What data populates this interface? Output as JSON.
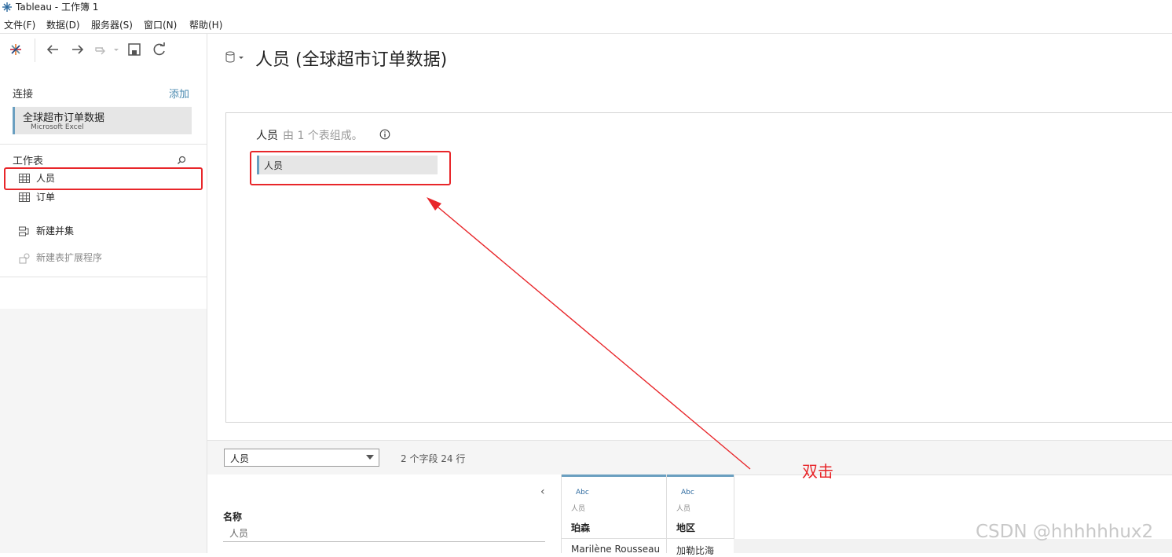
{
  "window": {
    "title": "Tableau - 工作簿 1"
  },
  "menu": {
    "items": [
      "文件(F)",
      "数据(D)",
      "服务器(S)",
      "窗口(N)",
      "帮助(H)"
    ]
  },
  "left_pane": {
    "connections_label": "连接",
    "add_label": "添加",
    "connection": {
      "name": "全球超市订单数据",
      "type": "Microsoft Excel"
    },
    "worksheets_label": "工作表",
    "sheets": [
      "人员",
      "订单"
    ],
    "new_union": "新建并集",
    "new_table_extension": "新建表扩展程序"
  },
  "main": {
    "title": "人员 (全球超市订单数据)",
    "canvas_table": "人员",
    "canvas_subtitle": "由 1 个表组成。",
    "pill_label": "人员"
  },
  "grid": {
    "table_select": "人员",
    "field_count": "2 个字段 24 行",
    "name_label": "名称",
    "name_value": "人员",
    "columns": [
      {
        "type": "Abc",
        "source": "人员",
        "name": "珀森",
        "first_value": "Marilène Rousseau"
      },
      {
        "type": "Abc",
        "source": "人员",
        "name": "地区",
        "first_value": "加勒比海"
      }
    ]
  },
  "annotation": {
    "text": "双击",
    "color": "#e8262a"
  },
  "watermark": "CSDN @hhhhhhux2",
  "colors": {
    "accent": "#6a9fc0",
    "link": "#4a8ab0",
    "annotation": "#e8262a"
  }
}
